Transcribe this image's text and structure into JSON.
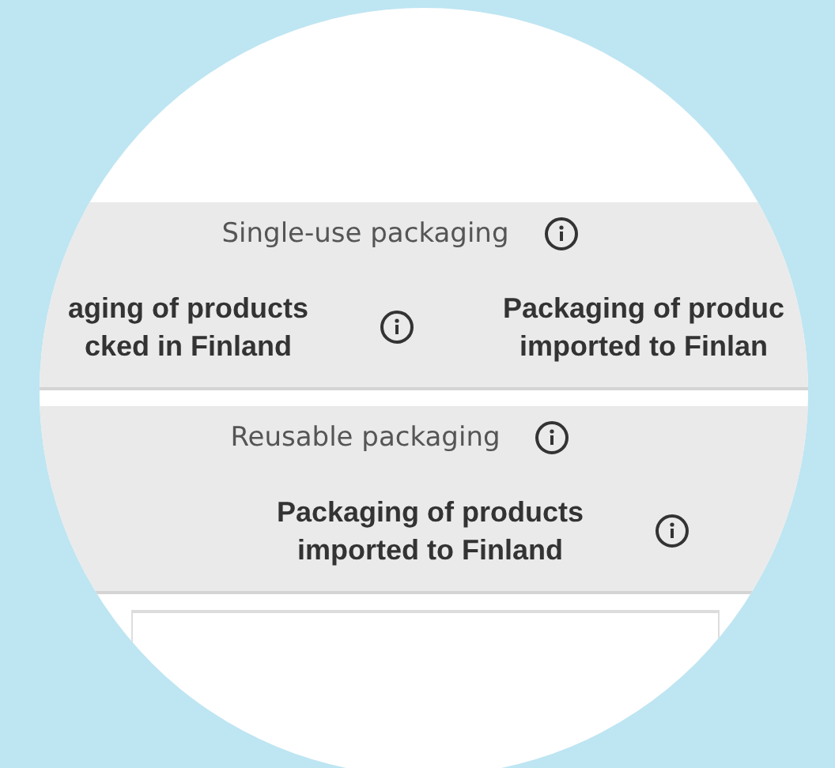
{
  "sections": [
    {
      "title": "Single-use packaging",
      "info": true,
      "columns": [
        {
          "lines": [
            "aging of products",
            "cked in Finland"
          ],
          "info": true
        },
        {
          "lines": [
            "Packaging of produc",
            "imported to Finlan"
          ]
        }
      ]
    },
    {
      "title": "Reusable packaging",
      "info": true,
      "columns": [
        {
          "lines": [
            "Packaging of products",
            "imported to Finland"
          ],
          "info": true
        }
      ]
    }
  ]
}
